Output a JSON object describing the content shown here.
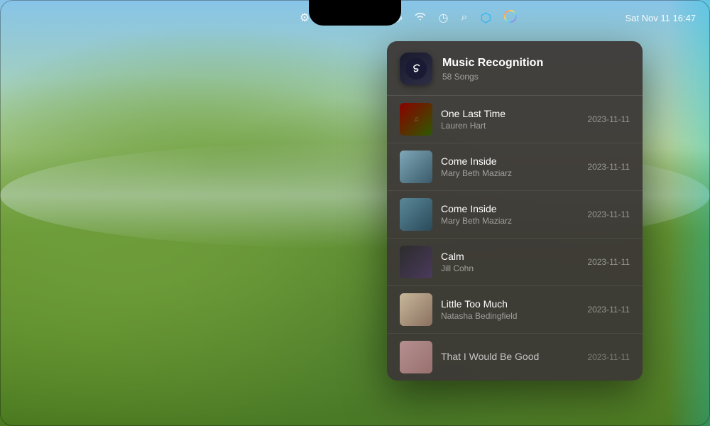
{
  "menubar": {
    "time": "Sat Nov 11  16:47",
    "icons": [
      "sliders-icon",
      "tuner-icon",
      "layers-icon",
      "antenna-icon",
      "battery-icon",
      "wifi-icon",
      "history-icon",
      "search-icon",
      "shazam-icon",
      "siri-icon"
    ]
  },
  "panel": {
    "title": "Music Recognition",
    "subtitle": "58 Songs",
    "songs": [
      {
        "id": 1,
        "title": "One Last Time",
        "artist": "Lauren Hart",
        "date": "2023-11-11",
        "art_class": "art-1"
      },
      {
        "id": 2,
        "title": "Come Inside",
        "artist": "Mary Beth Maziarz",
        "date": "2023-11-11",
        "art_class": "art-2"
      },
      {
        "id": 3,
        "title": "Come Inside",
        "artist": "Mary Beth Maziarz",
        "date": "2023-11-11",
        "art_class": "art-3"
      },
      {
        "id": 4,
        "title": "Calm",
        "artist": "Jill Cohn",
        "date": "2023-11-11",
        "art_class": "art-4"
      },
      {
        "id": 5,
        "title": "Little Too Much",
        "artist": "Natasha Bedingfield",
        "date": "2023-11-11",
        "art_class": "art-5"
      },
      {
        "id": 6,
        "title": "That I Would Be Good",
        "artist": "",
        "date": "2023-11-11",
        "art_class": "art-6"
      }
    ]
  }
}
